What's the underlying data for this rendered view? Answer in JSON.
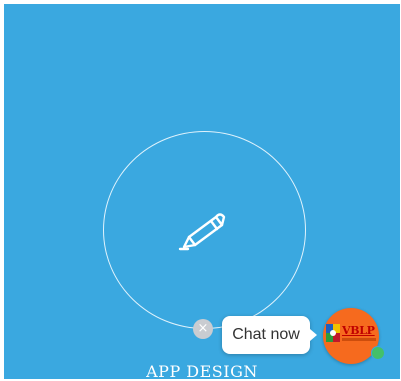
{
  "colors": {
    "background": "#3aa8e0",
    "circle_stroke": "#dff2fc",
    "chat_avatar_bg": "#f66a1e",
    "online_status": "#43c06a",
    "close_button_bg": "#c9ccd1"
  },
  "hero": {
    "icon": "pencil-icon",
    "title": "APP DESIGN"
  },
  "chat_widget": {
    "close_symbol": "×",
    "bubble_label": "Chat now",
    "avatar_text": "VBLP",
    "status": "online"
  }
}
